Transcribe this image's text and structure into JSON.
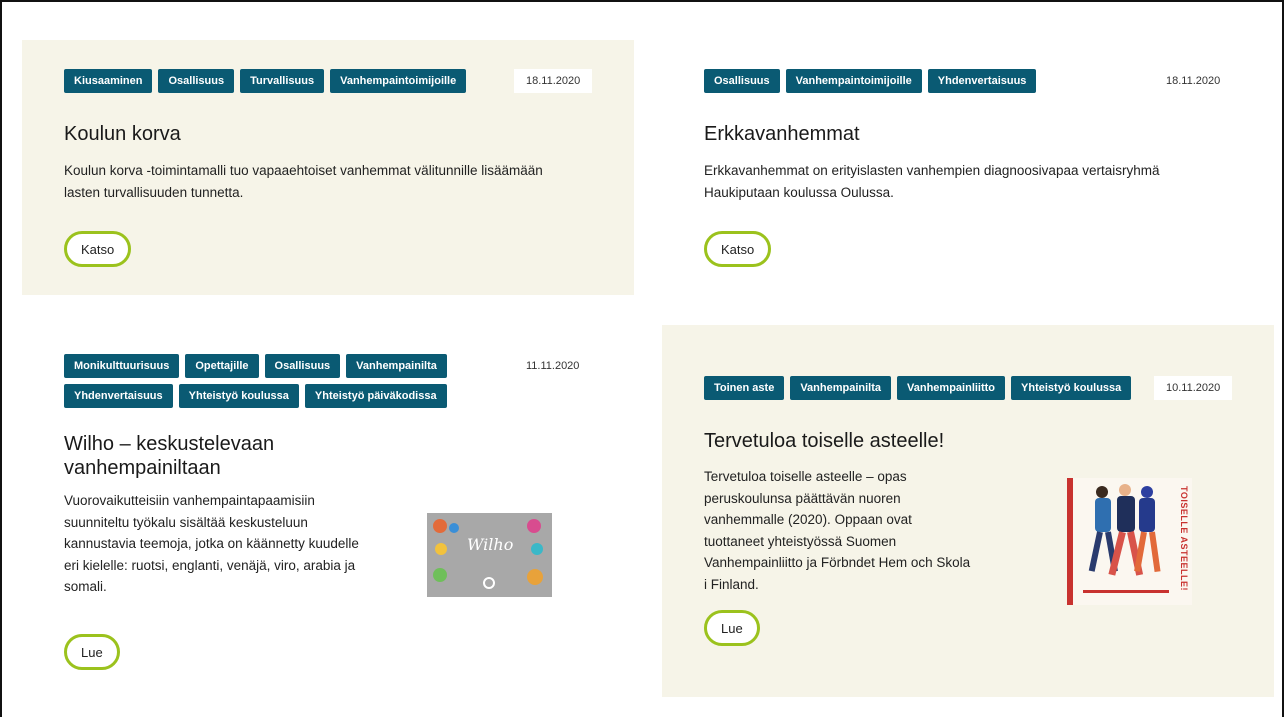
{
  "cards": [
    {
      "tags": [
        "Kiusaaminen",
        "Osallisuus",
        "Turvallisuus",
        "Vanhempaintoimijoille"
      ],
      "date": "18.11.2020",
      "title": "Koulun korva",
      "description": "Koulun korva -toimintamalli tuo vapaaehtoiset vanhemmat välitunnille lisäämään lasten turvallisuuden tunnetta.",
      "button": "Katso"
    },
    {
      "tags": [
        "Osallisuus",
        "Vanhempaintoimijoille",
        "Yhdenvertaisuus"
      ],
      "date": "18.11.2020",
      "title": "Erkkavanhemmat",
      "description": "Erkkavanhemmat on erityislasten vanhempien diagnoosivapaa vertaisryhmä Haukiputaan koulussa Oulussa.",
      "button": "Katso"
    },
    {
      "tags": [
        "Monikulttuurisuus",
        "Opettajille",
        "Osallisuus",
        "Vanhempainilta",
        "Yhdenvertaisuus",
        "Yhteistyö koulussa",
        "Yhteistyö päiväkodissa"
      ],
      "date": "11.11.2020",
      "title": "Wilho – keskustelevaan vanhempainiltaan",
      "description": "Vuorovaikutteisiin vanhempaintapaamisiin suunniteltu työkalu sisältää keskusteluun kannustavia teemoja, jotka on käännetty kuudelle eri kielelle: ruotsi, englanti, venäjä, viro, arabia ja somali.",
      "button": "Lue",
      "image_text": "Wilho"
    },
    {
      "tags": [
        "Toinen aste",
        "Vanhempainilta",
        "Vanhempainliitto",
        "Yhteistyö koulussa"
      ],
      "date": "10.11.2020",
      "title": "Tervetuloa toiselle asteelle!",
      "description": "Tervetuloa toiselle asteelle – opas peruskoulunsa päättävän nuoren vanhemmalle (2020). Oppaan ovat tuottaneet yhteistyössä Suomen Vanhempainliitto ja Förbndet Hem och Skola i Finland.",
      "button": "Lue",
      "image_text": "TOISELLE ASTEELLE!"
    }
  ],
  "colors": {
    "tag_bg": "#0a5a73",
    "card_bg": "#f6f4e8",
    "button_border": "#9bc21d"
  }
}
